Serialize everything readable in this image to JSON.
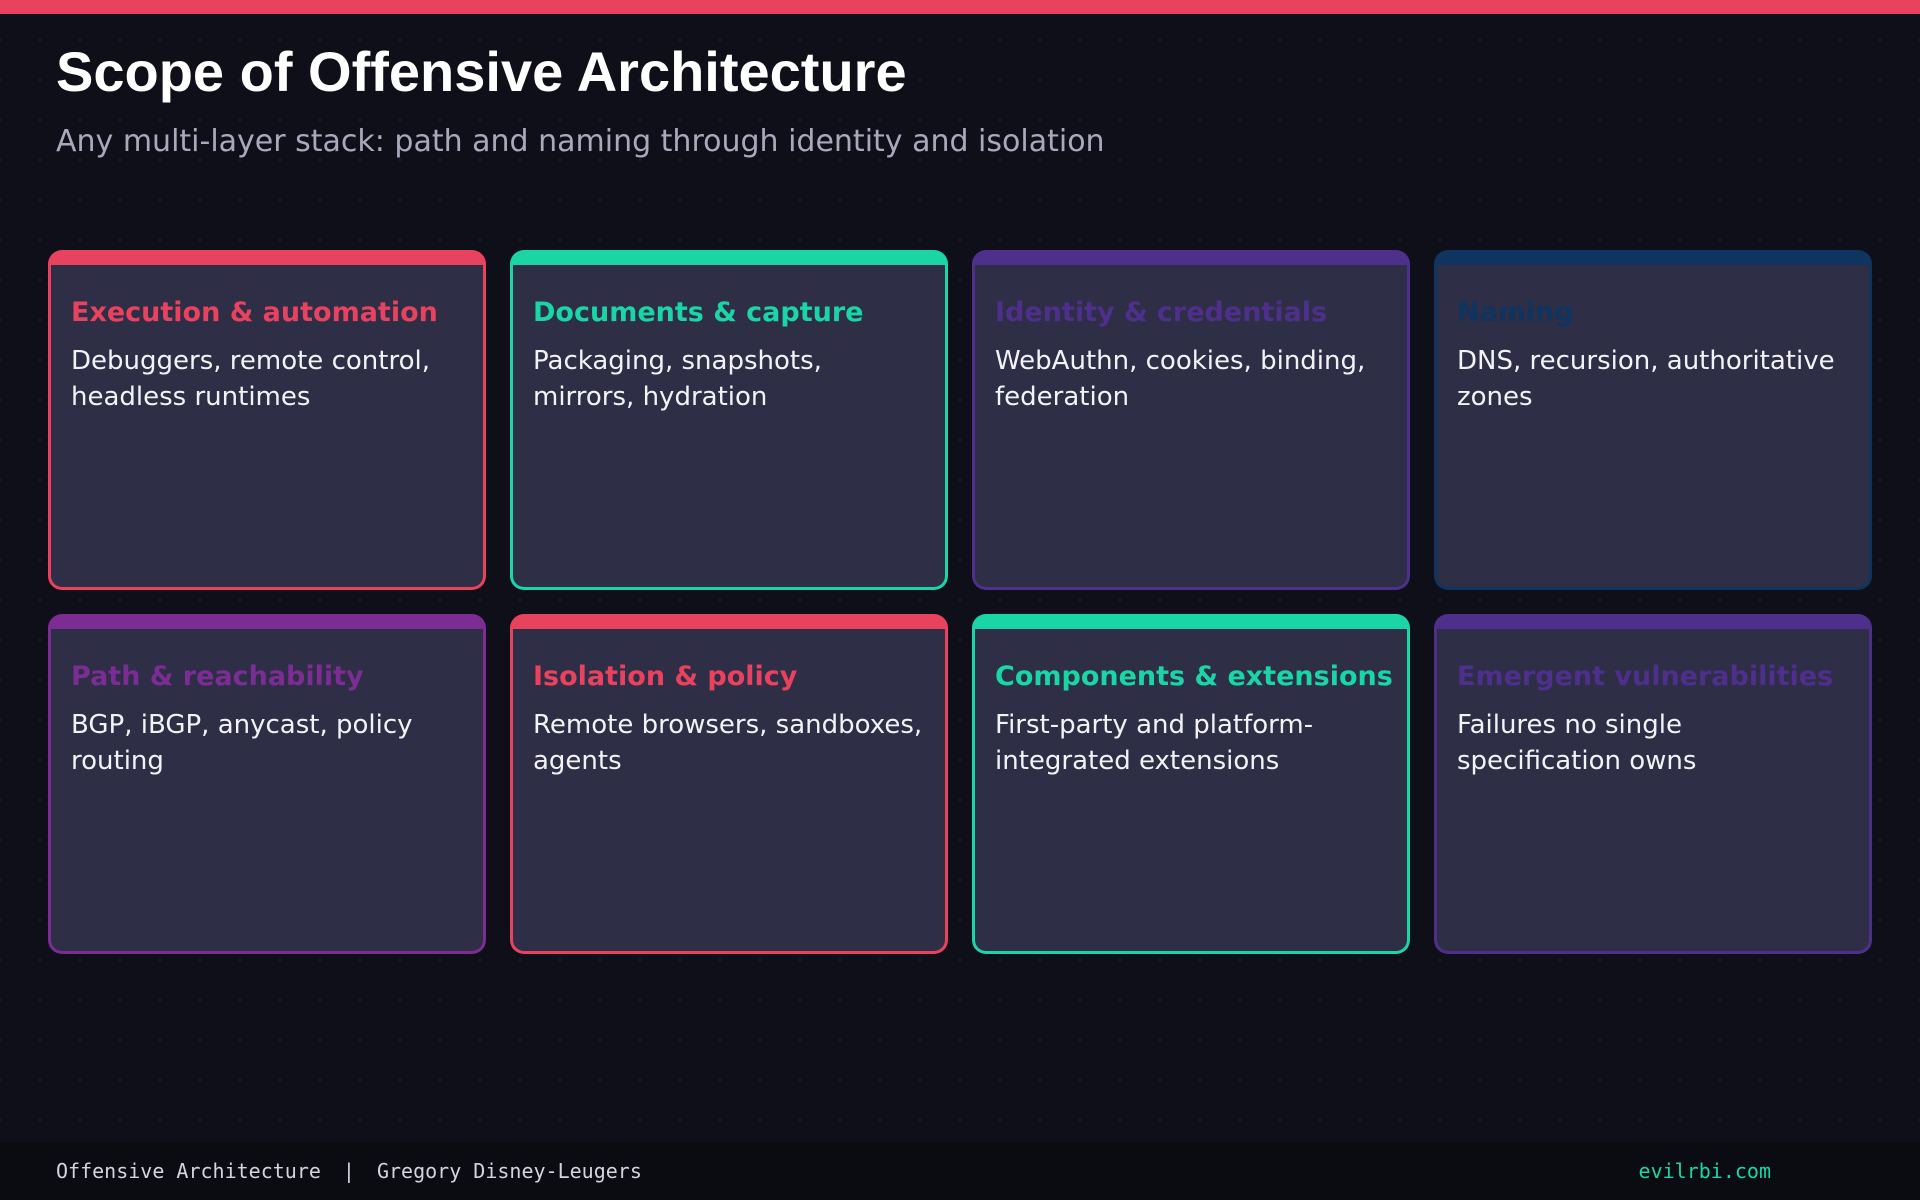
{
  "slide": {
    "title": "Scope of Offensive Architecture",
    "subtitle": "Any multi-layer stack: path and naming through identity and isolation",
    "accent_color": "#e8425f"
  },
  "cards": [
    {
      "title": "Execution & automation",
      "description": "Debuggers, remote control, headless runtimes",
      "color": "#e8425f"
    },
    {
      "title": "Documents & capture",
      "description": "Packaging, snapshots, mirrors, hydration",
      "color": "#1ad6a6"
    },
    {
      "title": "Identity & credentials",
      "description": "WebAuthn, cookies, binding, federation",
      "color": "#4e2f8c"
    },
    {
      "title": "Naming",
      "description": "DNS, recursion, authoritative zones",
      "color": "#0f3460"
    },
    {
      "title": "Path & reachability",
      "description": "BGP, iBGP, anycast, policy routing",
      "color": "#7b2d94"
    },
    {
      "title": "Isolation & policy",
      "description": "Remote browsers, sandboxes, agents",
      "color": "#e8425f"
    },
    {
      "title": "Components & extensions",
      "description": "First-party and platform-integrated extensions",
      "color": "#1ad6a6"
    },
    {
      "title": "Emergent vulnerabilities",
      "description": "Failures no single specification owns",
      "color": "#4e2f8c"
    }
  ],
  "footer": {
    "course": "Offensive Architecture",
    "separator": "|",
    "author": "Gregory Disney-Leugers",
    "site": "evilrbi.com",
    "site_color": "#1ad6a6"
  }
}
